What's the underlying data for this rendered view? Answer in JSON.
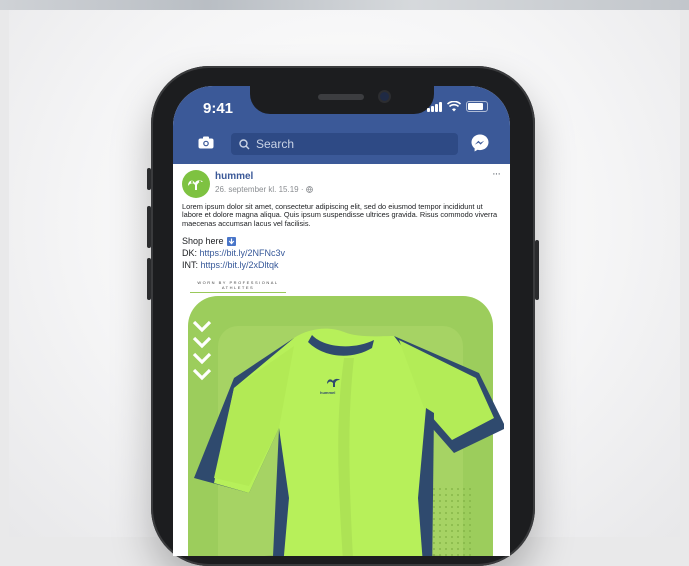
{
  "status_bar": {
    "time": "9:41"
  },
  "header": {
    "search_placeholder": "Search"
  },
  "post": {
    "author": "hummel",
    "meta": "26. september kl. 15.19 ·",
    "body": "Lorem ipsum dolor sit amet, consectetur adipiscing elit, sed do eiusmod tempor incididunt ut labore et dolore magna aliqua. Quis ipsum suspendisse ultrices gravida. Risus commodo viverra maecenas accumsan lacus vel facilisis.",
    "shop_label": "Shop here",
    "links": [
      {
        "prefix": "DK:",
        "url": "https://bit.ly/2NFNc3v"
      },
      {
        "prefix": "INT:",
        "url": "https://bit.ly/2xDltqk"
      }
    ],
    "more": "···"
  },
  "ad": {
    "tagline": "WORN BY PROFESSIONAL ATHLETES",
    "shirt_logo": "hummel"
  },
  "colors": {
    "facebook_blue": "#3b5998",
    "link_blue": "#365899",
    "brand_green": "#9ccd5c",
    "jersey_lime": "#b7f05a",
    "jersey_navy": "#2f4a6e"
  },
  "icons": [
    "camera-icon",
    "search-icon",
    "messenger-icon",
    "globe-icon",
    "down-arrow-icon",
    "chevron-icon",
    "hummel-logo-icon"
  ]
}
